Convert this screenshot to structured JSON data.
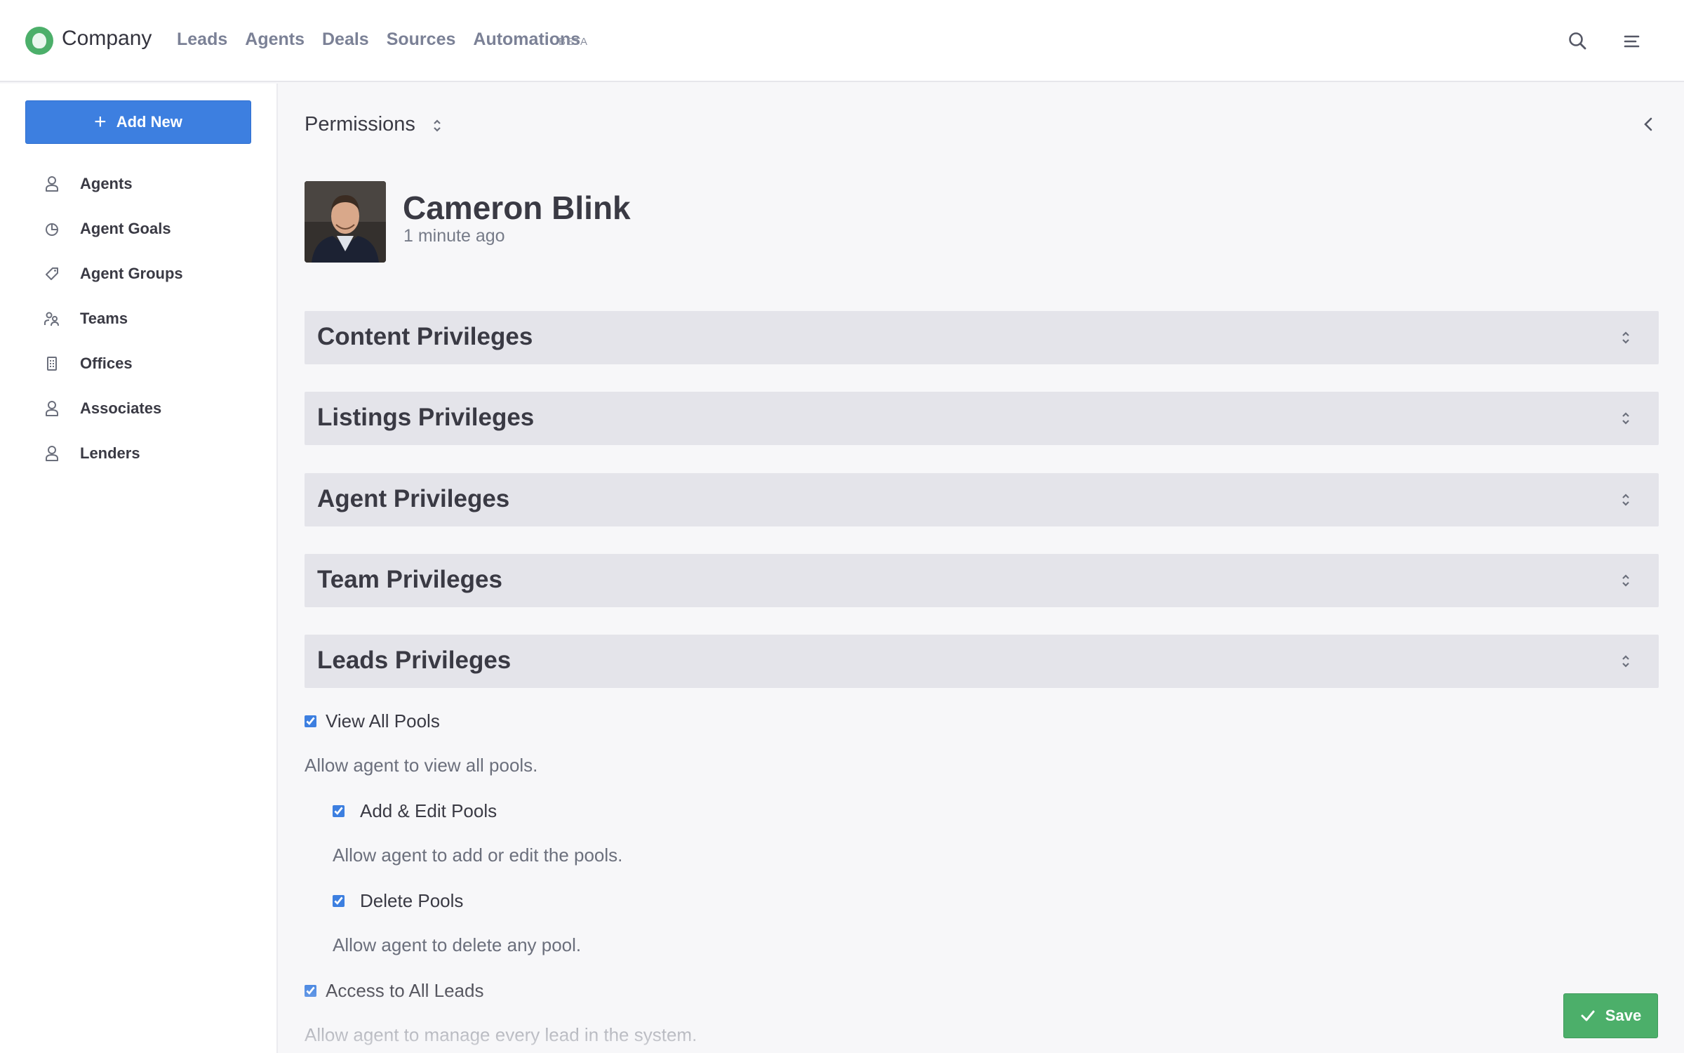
{
  "brand": {
    "name": "Company"
  },
  "nav": {
    "links": [
      "Leads",
      "Agents",
      "Deals",
      "Sources",
      "Automations"
    ],
    "beta": "BETA"
  },
  "sidebar": {
    "add_new": "Add New",
    "items": [
      {
        "label": "Agents",
        "icon": "user-icon"
      },
      {
        "label": "Agent Goals",
        "icon": "pie-chart-icon"
      },
      {
        "label": "Agent Groups",
        "icon": "tag-icon"
      },
      {
        "label": "Teams",
        "icon": "team-icon"
      },
      {
        "label": "Offices",
        "icon": "building-icon"
      },
      {
        "label": "Associates",
        "icon": "user-icon"
      },
      {
        "label": "Lenders",
        "icon": "user-icon"
      }
    ]
  },
  "main": {
    "title": "Permissions",
    "agent": {
      "name": "Cameron Blink",
      "updated": "1 minute ago"
    },
    "sections": [
      "Content Privileges",
      "Listings Privileges",
      "Agent Privileges",
      "Team Privileges",
      "Leads Privileges"
    ],
    "permissions": [
      {
        "label": "View All Pools",
        "desc": "Allow agent to view all pools.",
        "checked": true
      },
      {
        "label": "Add & Edit Pools",
        "desc": "Allow agent to add or edit the pools.",
        "checked": true
      },
      {
        "label": "Delete Pools",
        "desc": "Allow agent to delete any pool.",
        "checked": true
      },
      {
        "label": "Access to All Leads",
        "desc": "Allow agent to manage every lead in the system.",
        "checked": true
      }
    ]
  },
  "actions": {
    "save": "Save"
  },
  "colors": {
    "primary": "#3d7fe0",
    "success": "#4caf6a",
    "section_bg": "#e4e4ea"
  }
}
